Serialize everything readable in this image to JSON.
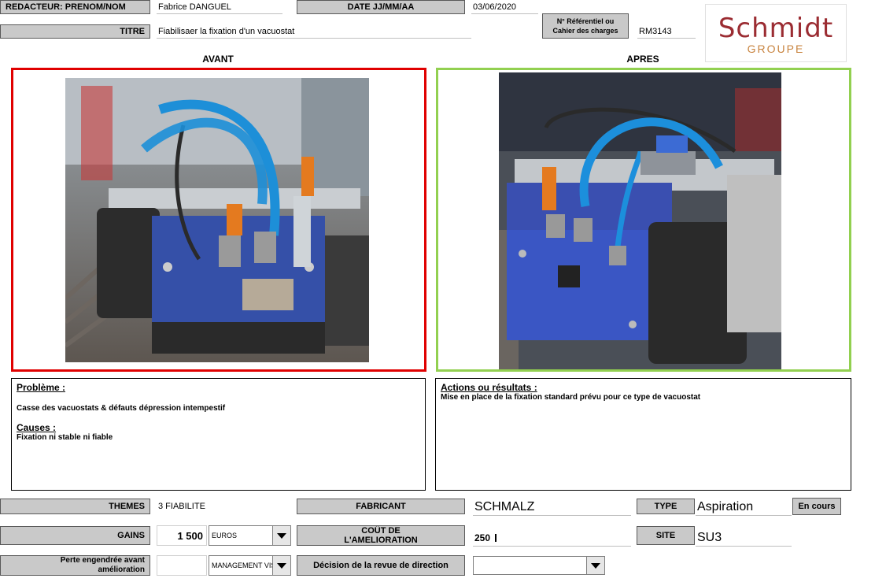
{
  "header": {
    "redacteur_label": "REDACTEUR: PRENOM/NOM",
    "redacteur_value": "Fabrice DANGUEL",
    "date_label": "DATE JJ/MM/AA",
    "date_value": "03/06/2020",
    "titre_label": "TITRE",
    "titre_value": "Fiabilisaer la fixation d'un vacuostat",
    "ref_label": "N° Référentiel ou Cahier des charges",
    "ref_value": "RM3143",
    "logo_main": "Schmidt",
    "logo_sub": "GROUPE"
  },
  "avant": {
    "title": "AVANT",
    "border_color": "#e00000"
  },
  "apres": {
    "title": "APRES",
    "border_color": "#92d050"
  },
  "probleme": {
    "title": "Problème :",
    "text": "Casse des vacuostats & défauts dépression intempestif",
    "causes_title": "Causes :",
    "causes_text": "Fixation ni stable ni fiable"
  },
  "actions": {
    "title": "Actions ou résultats :",
    "text": "Mise en place de la fixation standard prévu pour ce type de vacuostat"
  },
  "footer": {
    "themes_label": "THEMES",
    "themes_value": "3 FIABILITE",
    "fabricant_label": "FABRICANT",
    "fabricant_value": "SCHMALZ",
    "type_label": "TYPE",
    "type_value": "Aspiration",
    "status_button": "En cours",
    "gains_label": "GAINS",
    "gains_value": "1 500",
    "gains_unit": "EUROS",
    "cout_label_1": "COÛT DE",
    "cout_label_2": "L'AMELIORATION",
    "cout_value": "250",
    "site_label": "SITE",
    "site_value": "SU3",
    "perte_label_1": "Perte engendrée avant",
    "perte_label_2": "amélioration",
    "perte_value": "",
    "perte_unit": "MANAGEMENT VIS",
    "decision_label": "Décision de la revue de direction",
    "decision_value": ""
  }
}
